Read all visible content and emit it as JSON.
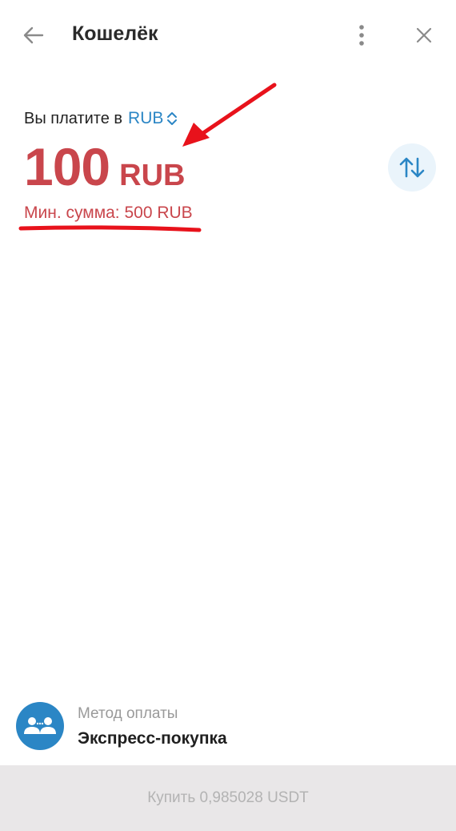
{
  "header": {
    "title": "Кошелёк",
    "back_icon": "arrow-left-icon",
    "more_icon": "more-vertical-icon",
    "close_icon": "close-icon"
  },
  "payment": {
    "pay_label": "Вы платите в",
    "currency": "RUB",
    "amount": "100",
    "amount_currency": "RUB",
    "min_sum": "Мин. сумма: 500 RUB"
  },
  "payment_method": {
    "label": "Метод оплаты",
    "value": "Экспресс-покупка"
  },
  "buy_button": {
    "label": "Купить 0,985028 USDT"
  },
  "colors": {
    "accent": "#2b86c5",
    "error": "#c9464c",
    "annotation": "#e8121b",
    "disabled_bg": "#e9e7e8",
    "disabled_text": "#b3b3b3"
  }
}
